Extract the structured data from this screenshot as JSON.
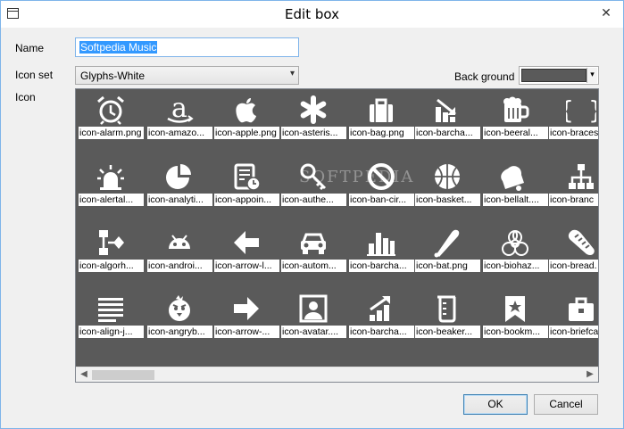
{
  "window": {
    "title": "Edit box",
    "close_glyph": "✕"
  },
  "form": {
    "name_label": "Name",
    "name_value": "Softpedia Music",
    "iconset_label": "Icon set",
    "iconset_value": "Glyphs-White",
    "background_label": "Back ground",
    "background_color": "#5a5a5a",
    "icon_label": "Icon"
  },
  "icons": [
    [
      "icon-alarm.png",
      "icon-amazo...",
      "icon-apple.png",
      "icon-asteris...",
      "icon-bag.png",
      "icon-barcha...",
      "icon-beeral...",
      "icon-braces"
    ],
    [
      "icon-alertal...",
      "icon-analyti...",
      "icon-appoin...",
      "icon-authe...",
      "icon-ban-cir...",
      "icon-basket...",
      "icon-bellalt....",
      "icon-branc"
    ],
    [
      "icon-algorh...",
      "icon-androi...",
      "icon-arrow-l...",
      "icon-autom...",
      "icon-barcha...",
      "icon-bat.png",
      "icon-biohaz...",
      "icon-bread."
    ],
    [
      "icon-align-j...",
      "icon-angryb...",
      "icon-arrow-...",
      "icon-avatar....",
      "icon-barcha...",
      "icon-beaker...",
      "icon-bookm...",
      "icon-briefca"
    ]
  ],
  "icon_names": [
    [
      "alarm-icon",
      "amazon-icon",
      "apple-icon",
      "asterisk-icon",
      "bag-icon",
      "barchart-down-icon",
      "beer-icon",
      "braces-icon"
    ],
    [
      "alert-light-icon",
      "analytics-icon",
      "appointment-icon",
      "authentication-icon",
      "ban-circle-icon",
      "basketball-icon",
      "bell-icon",
      "branch-icon"
    ],
    [
      "algorithm-icon",
      "android-icon",
      "arrow-left-icon",
      "automobile-icon",
      "barchart-icon",
      "bat-icon",
      "biohazard-icon",
      "bread-icon"
    ],
    [
      "align-justify-icon",
      "angry-bird-icon",
      "arrow-right-icon",
      "avatar-icon",
      "barchart-up-icon",
      "beaker-icon",
      "bookmark-icon",
      "briefcase-icon"
    ]
  ],
  "watermark": "SOFTPEDIA",
  "buttons": {
    "ok": "OK",
    "cancel": "Cancel"
  },
  "scroll": {
    "left": "◀",
    "right": "▶"
  },
  "dropdown_arrow": "▾"
}
